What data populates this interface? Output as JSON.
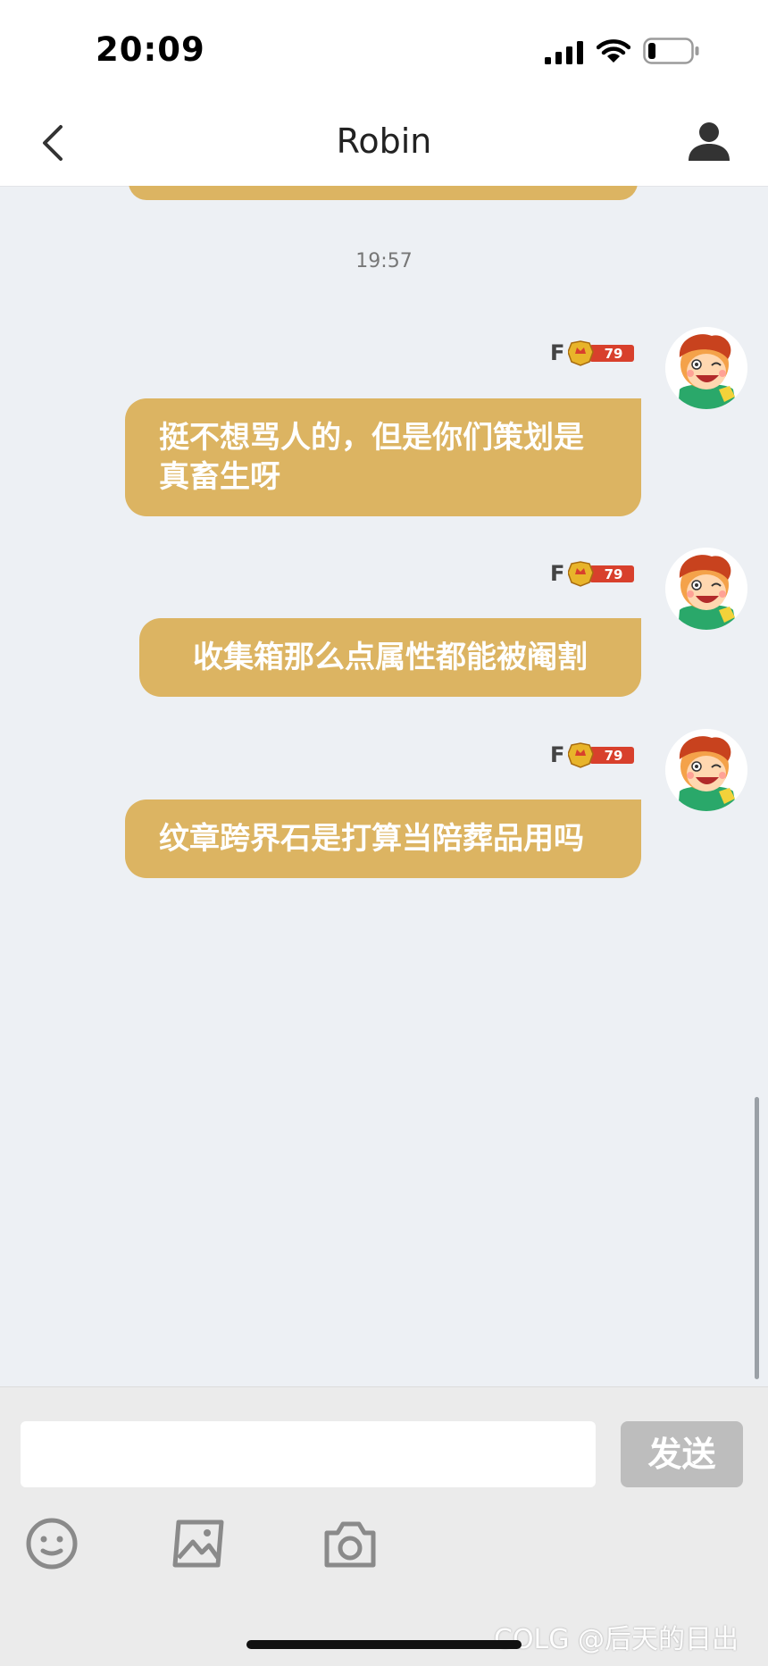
{
  "status_bar": {
    "time": "20:09"
  },
  "header": {
    "title": "Robin"
  },
  "chat": {
    "timestamp": "19:57",
    "messages": [
      {
        "sender_level": "F",
        "badge_level": "79",
        "text": "挺不想骂人的，但是你们策划是真畜生呀"
      },
      {
        "sender_level": "F",
        "badge_level": "79",
        "text": "收集箱那么点属性都能被阉割"
      },
      {
        "sender_level": "F",
        "badge_level": "79",
        "text": "纹章跨界石是打算当陪葬品用吗"
      }
    ]
  },
  "input": {
    "placeholder": "",
    "send_label": "发送"
  },
  "watermark": "COLG @后天的日出",
  "colors": {
    "bubble": "#dcb462",
    "chat_bg": "#edf0f4",
    "send_disabled": "#bdbdbd",
    "badge_red": "#d8402c"
  }
}
